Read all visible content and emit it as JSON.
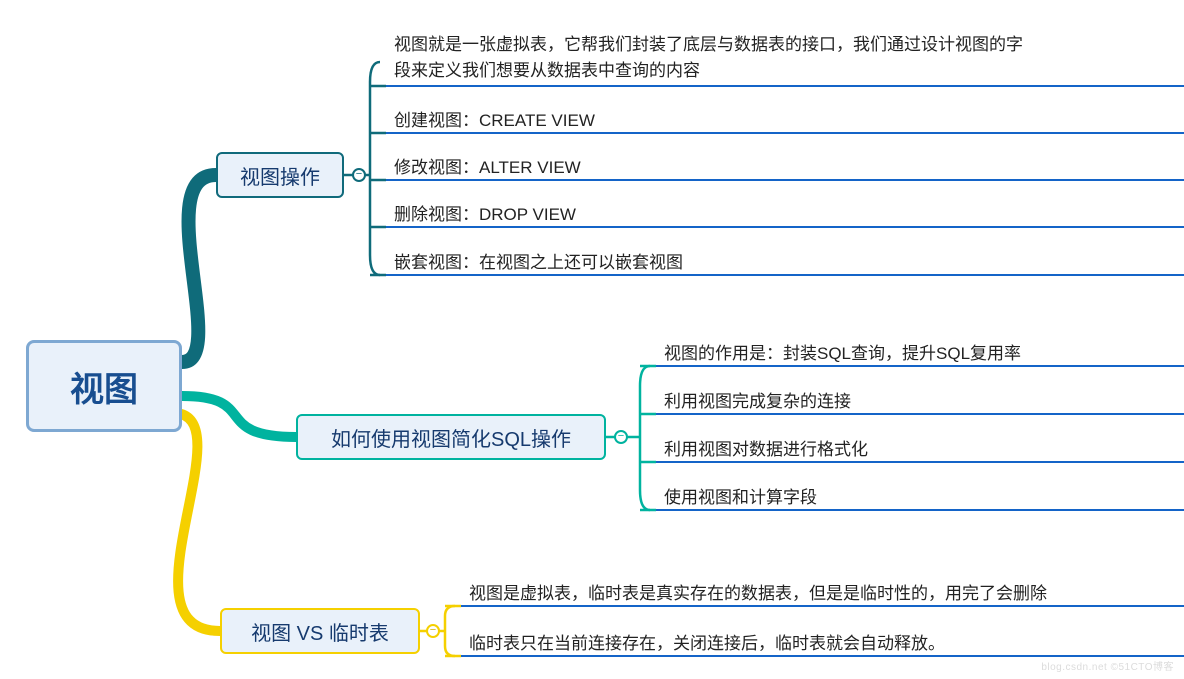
{
  "root": {
    "label": "视图"
  },
  "branches": [
    {
      "label": "视图操作",
      "color": "#106a7b",
      "leaf_color": "#1464c8",
      "leaves": [
        "视图就是一张虚拟表，它帮我们封装了底层与数据表的接口，我们通过设计视图的字\n段来定义我们想要从数据表中查询的内容",
        "创建视图：CREATE VIEW",
        "修改视图：ALTER VIEW",
        "删除视图：DROP VIEW",
        "嵌套视图：在视图之上还可以嵌套视图"
      ]
    },
    {
      "label": "如何使用视图简化SQL操作",
      "color": "#00b39f",
      "leaf_color": "#1464c8",
      "leaves": [
        "视图的作用是：封装SQL查询，提升SQL复用率",
        "利用视图完成复杂的连接",
        "利用视图对数据进行格式化",
        "使用视图和计算字段"
      ]
    },
    {
      "label": "视图 VS 临时表",
      "color": "#f5d000",
      "leaf_color": "#1464c8",
      "leaves": [
        "视图是虚拟表，临时表是真实存在的数据表，但是是临时性的，用完了会删除",
        "临时表只在当前连接存在，关闭连接后，临时表就会自动释放。"
      ]
    }
  ],
  "watermark": "blog.csdn.net ©51CTO博客"
}
